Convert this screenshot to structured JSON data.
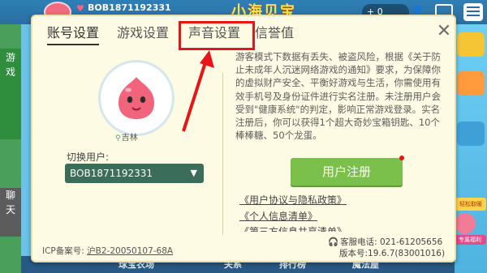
{
  "background": {
    "user_id": "BOB1871192331",
    "currency": "+ 0",
    "left_tabs": [
      "游\n戏",
      "聊\n天"
    ],
    "bottom_nav": [
      "球宝农场",
      "关系",
      "排行榜",
      "魔法屋"
    ],
    "badge": "轻松取暖",
    "shop": "专属福利"
  },
  "modal": {
    "tabs": [
      "账号设置",
      "游戏设置",
      "声音设置",
      "信誉值"
    ],
    "active_tab": "账号设置",
    "highlighted_tab": "声音设置",
    "close_icon": "close-icon",
    "location": "吉林",
    "switch_user_label": "切换用户:",
    "selected_user": "BOB1871192331",
    "notice": "游客模式下数据有丢失、被盗风险，根据《关于防止未成年人沉迷网络游戏的通知》要求，为保障你的虚拟财产安全、平衡好游戏与生活，你需使用有效手机号及身份证件进行实名注册。未注册用户会受到\"健康系统\"的判定，影响正常游戏登录。实名注册后，你可以获得1个超大奇妙宝箱钥匙、10个棒棒糖、50个龙蛋。",
    "register_button": "用户注册",
    "links": [
      "《用户协议与隐私政策》",
      "《个人信息清单》",
      "《第三方信息共享清单》"
    ],
    "icp": "ICP备案号:",
    "icp_number": "沪B2-20050107-68A",
    "service_phone": "客服电话: 021-61205656",
    "version": "版本号:19.6.7(83001016)"
  },
  "colors": {
    "highlight": "#e8141a",
    "register": "#7cc04c",
    "modal_bg": "#fdfbe3"
  }
}
